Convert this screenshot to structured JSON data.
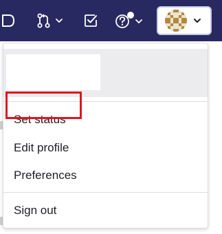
{
  "topbar": {
    "icons": [
      {
        "name": "issues-icon"
      },
      {
        "name": "merge-requests-icon"
      },
      {
        "name": "todos-icon"
      },
      {
        "name": "help-icon"
      }
    ],
    "avatar": {
      "name": "user-avatar"
    }
  },
  "dropdown": {
    "profile_header": "",
    "items": [
      {
        "label": "Set status"
      },
      {
        "label": "Edit profile",
        "highlighted": true
      },
      {
        "label": "Preferences"
      },
      {
        "label": "Sign out"
      }
    ]
  },
  "colors": {
    "topbar": "#292961",
    "highlight": "#e0141c",
    "header_bg": "#ececef",
    "text": "#1f1e24"
  }
}
